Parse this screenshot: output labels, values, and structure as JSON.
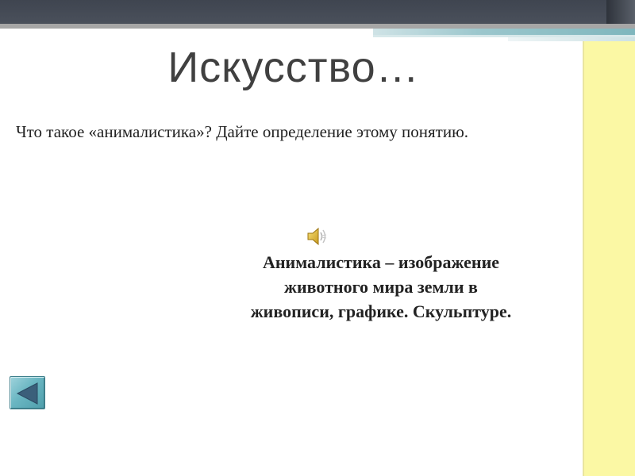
{
  "slide": {
    "title": "Искусство…",
    "question": "Что такое «анималистика»? Дайте определение этому понятию.",
    "answer_lines": [
      "Анималистика – изображение",
      "животного мира земли в",
      "живописи, графике. Скульптуре."
    ]
  },
  "icons": {
    "sound": "speaker-icon",
    "back": "back-arrow-icon"
  },
  "colors": {
    "header_dark": "#444a54",
    "accent_teal": "#7fb6bd",
    "sidebar_yellow": "#fbf8a4",
    "button_teal": "#6ab6c2",
    "text": "#404040"
  }
}
